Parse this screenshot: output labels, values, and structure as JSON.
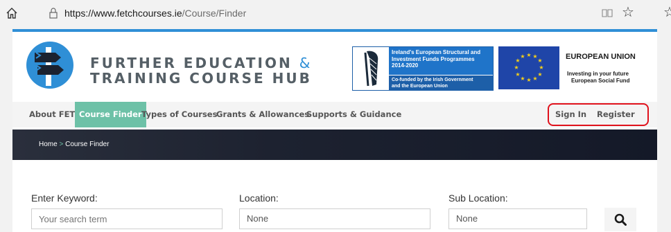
{
  "browser": {
    "url_host": "https://www.fetchcourses.ie",
    "url_path": "/Course/Finder"
  },
  "header": {
    "brand_line1": "FURTHER EDUCATION",
    "brand_amp": "&",
    "brand_line2": "TRAINING COURSE HUB",
    "esif_line1": "Ireland's European Structural and",
    "esif_line2": "Investment Funds Programmes",
    "esif_line3": "2014-2020",
    "esif_line4": "Co-funded by the Irish Government",
    "esif_line5": "and the European Union",
    "eu_title": "EUROPEAN UNION",
    "eu_sub1": "Investing in your future",
    "eu_sub2": "European Social Fund"
  },
  "nav": {
    "about": "About FET",
    "finder": "Course Finder",
    "types": "Types of Courses",
    "grants": "Grants & Allowances",
    "support": "Supports & Guidance",
    "signin": "Sign In",
    "register": "Register"
  },
  "breadcrumb": {
    "home": "Home",
    "sep": ">",
    "current": "Course Finder"
  },
  "form": {
    "keyword_label": "Enter Keyword:",
    "keyword_placeholder": "Your search term",
    "location_label": "Location:",
    "location_value": "None",
    "sublocation_label": "Sub Location:",
    "sublocation_value": "None"
  },
  "colors": {
    "accent_teal": "#6dc1a7",
    "brand_blue": "#2f8fd6",
    "highlight_red": "#e0111b"
  }
}
